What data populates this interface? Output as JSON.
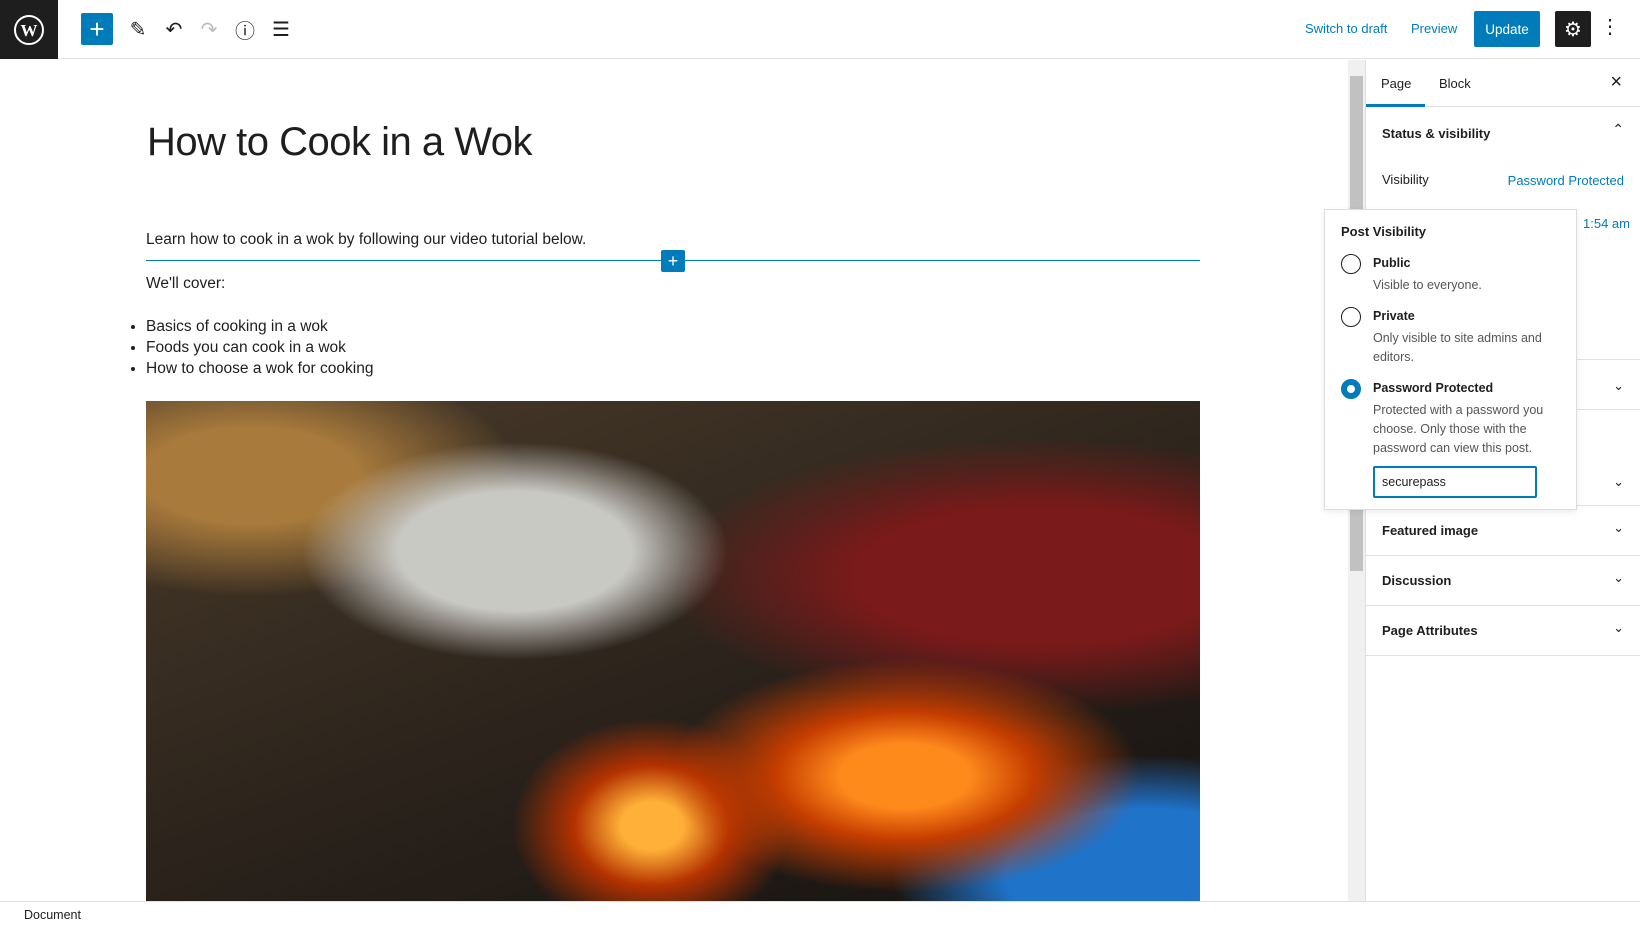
{
  "toolbar": {
    "switch_draft": "Switch to draft",
    "preview": "Preview",
    "update": "Update",
    "icons": [
      "wordpress-logo",
      "plus",
      "pencil",
      "undo",
      "redo",
      "info",
      "list-view",
      "gear",
      "more-vertical"
    ],
    "accent": "#007cba"
  },
  "editor": {
    "title": "How to Cook in a Wok",
    "intro": "Learn how to cook in a wok by following our video tutorial below.",
    "cover": "We'll cover:",
    "list": [
      "Basics of cooking in a wok",
      "Foods you can cook in a wok",
      "How to choose a wok for cooking"
    ]
  },
  "sidebar": {
    "tabs": [
      "Page",
      "Block"
    ],
    "status_title": "Status & visibility",
    "visibility_label": "Visibility",
    "visibility_value": "Password Protected",
    "publish_time": "1:54 am",
    "panels": [
      "Featured image",
      "Discussion",
      "Page Attributes"
    ]
  },
  "popover": {
    "title": "Post Visibility",
    "options": [
      {
        "label": "Public",
        "desc": "Visible to everyone."
      },
      {
        "label": "Private",
        "desc": "Only visible to site admins and editors."
      },
      {
        "label": "Password Protected",
        "desc": "Protected with a password you choose. Only those with the password can view this post."
      }
    ],
    "selected": "Password Protected",
    "password": "securepass"
  },
  "footer": {
    "breadcrumb": "Document"
  }
}
